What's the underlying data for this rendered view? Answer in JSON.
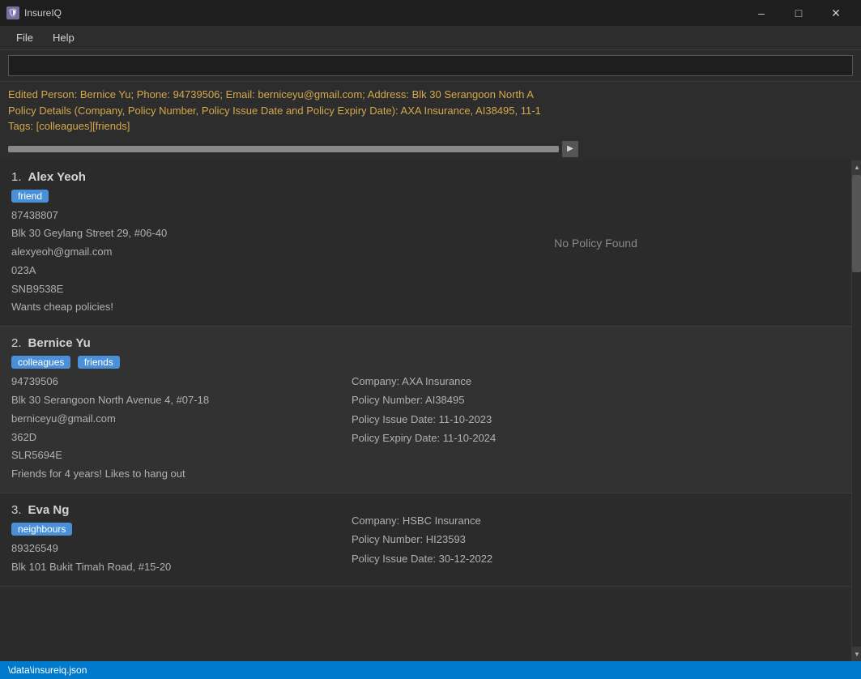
{
  "app": {
    "title": "InsureIQ",
    "icon": "🛡"
  },
  "titlebar": {
    "minimize": "–",
    "maximize": "□",
    "close": "✕"
  },
  "menu": {
    "items": [
      "File",
      "Help"
    ]
  },
  "search": {
    "placeholder": "",
    "value": ""
  },
  "notification": {
    "line1": "Edited Person: Bernice Yu; Phone: 94739506; Email: berniceyu@gmail.com; Address: Blk 30 Serangoon North A",
    "line2": "Policy Details (Company, Policy Number, Policy Issue Date and Policy Expiry Date): AXA Insurance, AI38495, 11-1",
    "line3": "Tags: [colleagues][friends]"
  },
  "persons": [
    {
      "index": "1.",
      "name": "Alex Yeoh",
      "tags": [
        "friend"
      ],
      "phone": "87438807",
      "address": "Blk 30 Geylang Street 29, #06-40",
      "email": "alexyeoh@gmail.com",
      "postal": "023A",
      "nric": "SNB9538E",
      "notes": "Wants cheap policies!",
      "policy": null,
      "no_policy_text": "No Policy Found"
    },
    {
      "index": "2.",
      "name": "Bernice Yu",
      "tags": [
        "colleagues",
        "friends"
      ],
      "phone": "94739506",
      "address": "Blk 30 Serangoon North Avenue 4, #07-18",
      "email": "berniceyu@gmail.com",
      "postal": "362D",
      "nric": "SLR5694E",
      "notes": "Friends for 4 years! Likes to hang out",
      "policy": {
        "company": "Company: AXA Insurance",
        "number": "Policy Number: AI38495",
        "issue_date": "Policy Issue Date: 11-10-2023",
        "expiry_date": "Policy Expiry Date: 11-10-2024"
      }
    },
    {
      "index": "3.",
      "name": "Eva Ng",
      "tags": [
        "neighbours"
      ],
      "phone": "89326549",
      "address": "Blk 101 Bukit Timah Road, #15-20",
      "email": "",
      "postal": "",
      "nric": "",
      "notes": "",
      "policy": {
        "company": "Company: HSBC Insurance",
        "number": "Policy Number: HI23593",
        "issue_date": "Policy Issue Date: 30-12-2022",
        "expiry_date": ""
      }
    }
  ],
  "status_bar": {
    "path": "\\data\\insureiq.json"
  }
}
